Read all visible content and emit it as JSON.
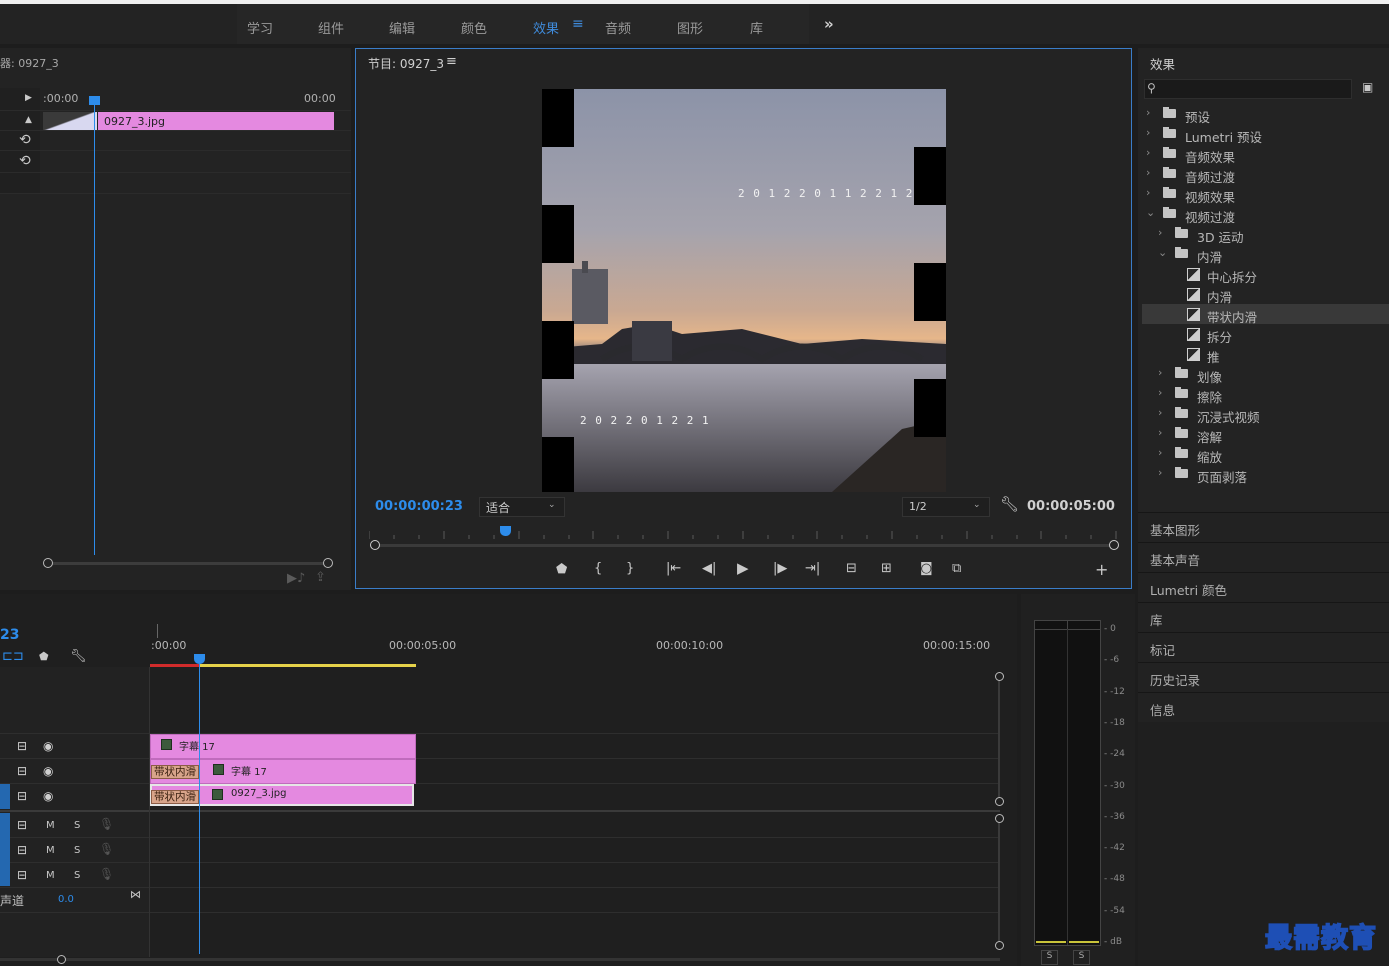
{
  "workspaces": [
    "学习",
    "组件",
    "编辑",
    "颜色",
    "效果",
    "音频",
    "图形",
    "库"
  ],
  "active_workspace": "效果",
  "more_label": "»",
  "source_panel": {
    "title": "器: 0927_3",
    "time_start": ":00:00",
    "time_end": "00:00",
    "clip_name": "0927_3.jpg"
  },
  "program_monitor": {
    "title": "节目: 0927_3",
    "current_time": "00:00:00:23",
    "fit_label": "适合",
    "resolution": "1/2",
    "duration": "00:00:05:00",
    "frame_text_top": "2 0 1 2 2 0 1 1 2 2 1 2",
    "frame_text_bottom": "2 0 2 2 0 1 2 2 1"
  },
  "effects_panel": {
    "title": "效果",
    "search_placeholder": "",
    "tree": [
      {
        "label": "预设",
        "level": 0,
        "kind": "starfolder",
        "open": false
      },
      {
        "label": "Lumetri 预设",
        "level": 0,
        "kind": "starfolder",
        "open": false
      },
      {
        "label": "音频效果",
        "level": 0,
        "kind": "folder",
        "open": false
      },
      {
        "label": "音频过渡",
        "level": 0,
        "kind": "folder",
        "open": false
      },
      {
        "label": "视频效果",
        "level": 0,
        "kind": "folder",
        "open": false
      },
      {
        "label": "视频过渡",
        "level": 0,
        "kind": "folder",
        "open": true
      },
      {
        "label": "3D 运动",
        "level": 1,
        "kind": "folder",
        "open": false
      },
      {
        "label": "内滑",
        "level": 1,
        "kind": "folder",
        "open": true
      },
      {
        "label": "中心拆分",
        "level": 2,
        "kind": "fx"
      },
      {
        "label": "内滑",
        "level": 2,
        "kind": "fx"
      },
      {
        "label": "带状内滑",
        "level": 2,
        "kind": "fx",
        "selected": true
      },
      {
        "label": "拆分",
        "level": 2,
        "kind": "fx"
      },
      {
        "label": "推",
        "level": 2,
        "kind": "fx"
      },
      {
        "label": "划像",
        "level": 1,
        "kind": "folder",
        "open": false
      },
      {
        "label": "擦除",
        "level": 1,
        "kind": "folder",
        "open": false
      },
      {
        "label": "沉浸式视频",
        "level": 1,
        "kind": "folder",
        "open": false
      },
      {
        "label": "溶解",
        "level": 1,
        "kind": "folder",
        "open": false
      },
      {
        "label": "缩放",
        "level": 1,
        "kind": "folder",
        "open": false
      },
      {
        "label": "页面剥落",
        "level": 1,
        "kind": "folder",
        "open": false
      }
    ]
  },
  "side_panels": [
    "基本图形",
    "基本声音",
    "Lumetri 颜色",
    "库",
    "标记",
    "历史记录",
    "信息"
  ],
  "timeline": {
    "current_time_short": "23",
    "ruler_labels": [
      ":00:00",
      "00:00:05:00",
      "00:00:10:00",
      "00:00:15:00"
    ],
    "clips": {
      "v3": "字幕 17",
      "v2": "字幕 17",
      "v1": "0927_3.jpg"
    },
    "transition_label": "带状内滑",
    "audio_track_labels": {
      "mute": "M",
      "solo": "S"
    },
    "master_label": "声道",
    "master_value": "0.0"
  },
  "audio_meter": {
    "scale": [
      "0",
      "-6",
      "-12",
      "-18",
      "-24",
      "-30",
      "-36",
      "-42",
      "-48",
      "-54",
      "dB"
    ],
    "solo_labels": [
      "S",
      "S"
    ]
  },
  "watermark": "最需教育",
  "colors": {
    "accent_blue": "#2d8ceb",
    "clip_pink": "#e489e0",
    "transition_tan": "#d8a48a",
    "work_area_yellow": "#e6d24a",
    "render_red": "#d02b2b"
  }
}
